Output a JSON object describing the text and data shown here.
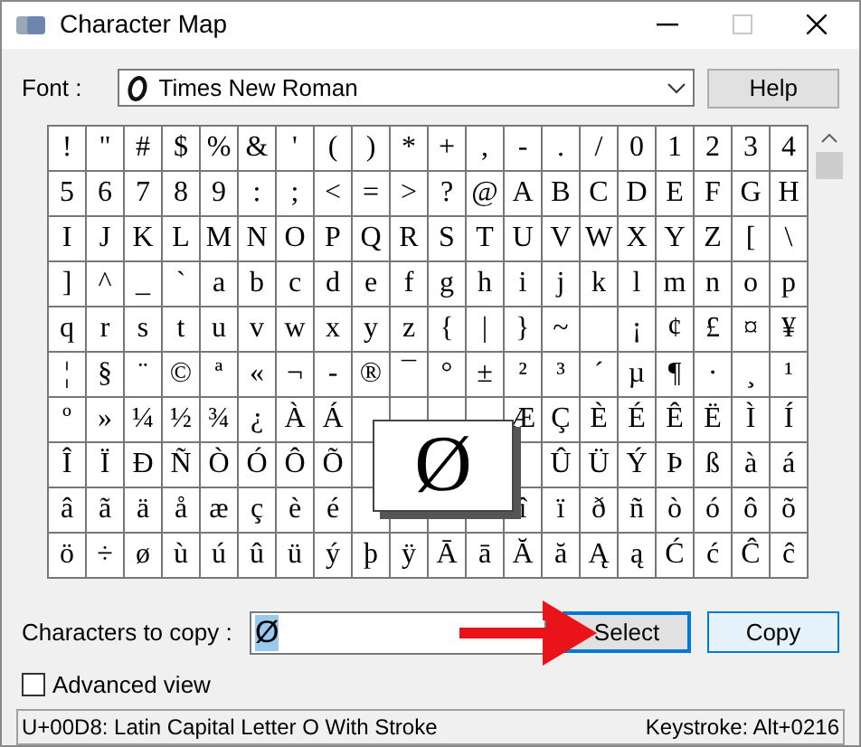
{
  "window": {
    "title": "Character Map",
    "maximize_enabled": false
  },
  "font": {
    "label": "Font :",
    "value": "Times New Roman"
  },
  "help_button": "Help",
  "grid": {
    "rows": [
      [
        "!",
        "\"",
        "#",
        "$",
        "%",
        "&",
        "'",
        "(",
        ")",
        "*",
        "+",
        ",",
        "-",
        ".",
        "/",
        "0",
        "1",
        "2",
        "3",
        "4"
      ],
      [
        "5",
        "6",
        "7",
        "8",
        "9",
        ":",
        ";",
        "<",
        "=",
        ">",
        "?",
        "@",
        "A",
        "B",
        "C",
        "D",
        "E",
        "F",
        "G",
        "H"
      ],
      [
        "I",
        "J",
        "K",
        "L",
        "M",
        "N",
        "O",
        "P",
        "Q",
        "R",
        "S",
        "T",
        "U",
        "V",
        "W",
        "X",
        "Y",
        "Z",
        "[",
        "\\"
      ],
      [
        "]",
        "^",
        "_",
        "`",
        "a",
        "b",
        "c",
        "d",
        "e",
        "f",
        "g",
        "h",
        "i",
        "j",
        "k",
        "l",
        "m",
        "n",
        "o",
        "p"
      ],
      [
        "q",
        "r",
        "s",
        "t",
        "u",
        "v",
        "w",
        "x",
        "y",
        "z",
        "{",
        "|",
        "}",
        "~",
        null,
        "¡",
        "¢",
        "£",
        "¤",
        "¥"
      ],
      [
        "¦",
        "§",
        "¨",
        "©",
        "ª",
        "«",
        "¬",
        "-",
        "®",
        "¯",
        "°",
        "±",
        "²",
        "³",
        "´",
        "µ",
        "¶",
        "·",
        "¸",
        "¹"
      ],
      [
        "º",
        "»",
        "¼",
        "½",
        "¾",
        "¿",
        "À",
        "Á",
        null,
        null,
        null,
        null,
        "Æ",
        "Ç",
        "È",
        "É",
        "Ê",
        "Ë",
        "Ì",
        "Í"
      ],
      [
        "Î",
        "Ï",
        "Ð",
        "Ñ",
        "Ò",
        "Ó",
        "Ô",
        "Õ",
        null,
        null,
        null,
        null,
        null,
        "Û",
        "Ü",
        "Ý",
        "Þ",
        "ß",
        "à",
        "á"
      ],
      [
        "â",
        "ã",
        "ä",
        "å",
        "æ",
        "ç",
        "è",
        "é",
        null,
        null,
        null,
        null,
        "î",
        "ï",
        "ð",
        "ñ",
        "ò",
        "ó",
        "ô",
        "õ"
      ],
      [
        "ö",
        "÷",
        "ø",
        "ù",
        "ú",
        "û",
        "ü",
        "ý",
        "þ",
        "ÿ",
        "Ā",
        "ā",
        "Ă",
        "ă",
        "Ą",
        "ą",
        "Ć",
        "ć",
        "Ĉ",
        "ĉ"
      ]
    ]
  },
  "enlarged_char": "Ø",
  "copy": {
    "label": "Characters to copy :",
    "value": "Ø",
    "value_selected": true
  },
  "select_button": {
    "label": "Select",
    "focused": true
  },
  "copy_button": "Copy",
  "advanced_view": {
    "label": "Advanced view",
    "checked": false
  },
  "status": {
    "description": "U+00D8: Latin Capital Letter O With Stroke",
    "keystroke": "Keystroke: Alt+0216"
  }
}
